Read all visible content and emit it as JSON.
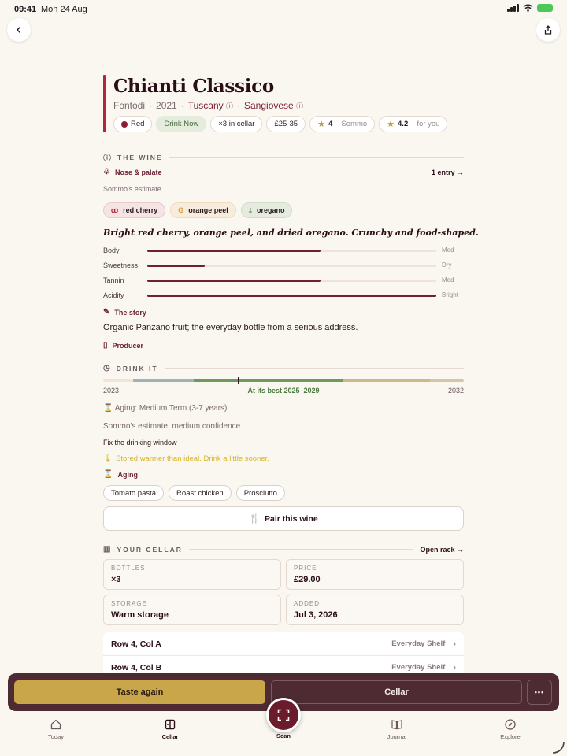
{
  "status": {
    "time": "09:41",
    "date": "Mon 24 Aug"
  },
  "wine": {
    "name": "Chianti Classico",
    "producer": "Fontodi",
    "vintage": "2021",
    "region": "Tuscany",
    "grape": "Sangiovese",
    "chips": {
      "color": "Red",
      "drink_now": "Drink Now",
      "in_cellar": "×3 in cellar",
      "price_range": "£25-35",
      "sommo_score": "4",
      "sommo_label": "Sommo",
      "personal_score": "4.2",
      "personal_label": "for you"
    }
  },
  "the_wine": {
    "heading": "THE WINE",
    "nose_label": "Nose & palate",
    "entries": "1 entry →",
    "estimate": "Sommo's estimate",
    "flavors": [
      "red cherry",
      "orange peel",
      "oregano"
    ],
    "tagline": "Bright red cherry, orange peel, and dried oregano. Crunchy and food-shaped.",
    "profile": [
      {
        "name": "Body",
        "level": 0.6,
        "end": "Med"
      },
      {
        "name": "Sweetness",
        "level": 0.2,
        "end": "Dry"
      },
      {
        "name": "Tannin",
        "level": 0.6,
        "end": "Med"
      },
      {
        "name": "Acidity",
        "level": 1.0,
        "end": "Bright"
      }
    ],
    "story_label": "The story",
    "story": "Organic Panzano fruit; the everyday bottle from a serious address.",
    "producer_label": "Producer"
  },
  "drink_it": {
    "heading": "DRINK IT",
    "start_year": "2023",
    "end_year": "2032",
    "best": "At its best 2025–2029",
    "aging": "Aging: Medium Term (3-7 years)",
    "confidence": "Sommo's estimate, medium confidence",
    "fix_link": "Fix the drinking window",
    "warning": "Stored warmer than ideal. Drink a little sooner.",
    "aging_label": "Aging",
    "pairings": [
      "Tomato pasta",
      "Roast chicken",
      "Prosciutto"
    ],
    "pair_button": "Pair this wine"
  },
  "cellar": {
    "heading": "YOUR CELLAR",
    "open_rack": "Open rack →",
    "bottles_key": "BOTTLES",
    "bottles_val": "×3",
    "price_key": "PRICE",
    "price_val": "£29.00",
    "storage_key": "STORAGE",
    "storage_val": "Warm storage",
    "added_key": "ADDED",
    "added_val": "Jul 3, 2026",
    "rows": [
      {
        "pos": "Row 4, Col A",
        "shelf": "Everyday Shelf"
      },
      {
        "pos": "Row 4, Col B",
        "shelf": "Everyday Shelf"
      }
    ]
  },
  "actions": {
    "taste": "Taste again",
    "cellar": "Cellar",
    "more": "•••"
  },
  "tabs": {
    "today": "Today",
    "cellar": "Cellar",
    "scan": "Scan",
    "journal": "Journal",
    "explore": "Explore"
  },
  "colors": {
    "accent": "#b3243a",
    "wine": "#6e1f30",
    "gold": "#c9a64a",
    "bar_bg": "#4e2a33"
  }
}
